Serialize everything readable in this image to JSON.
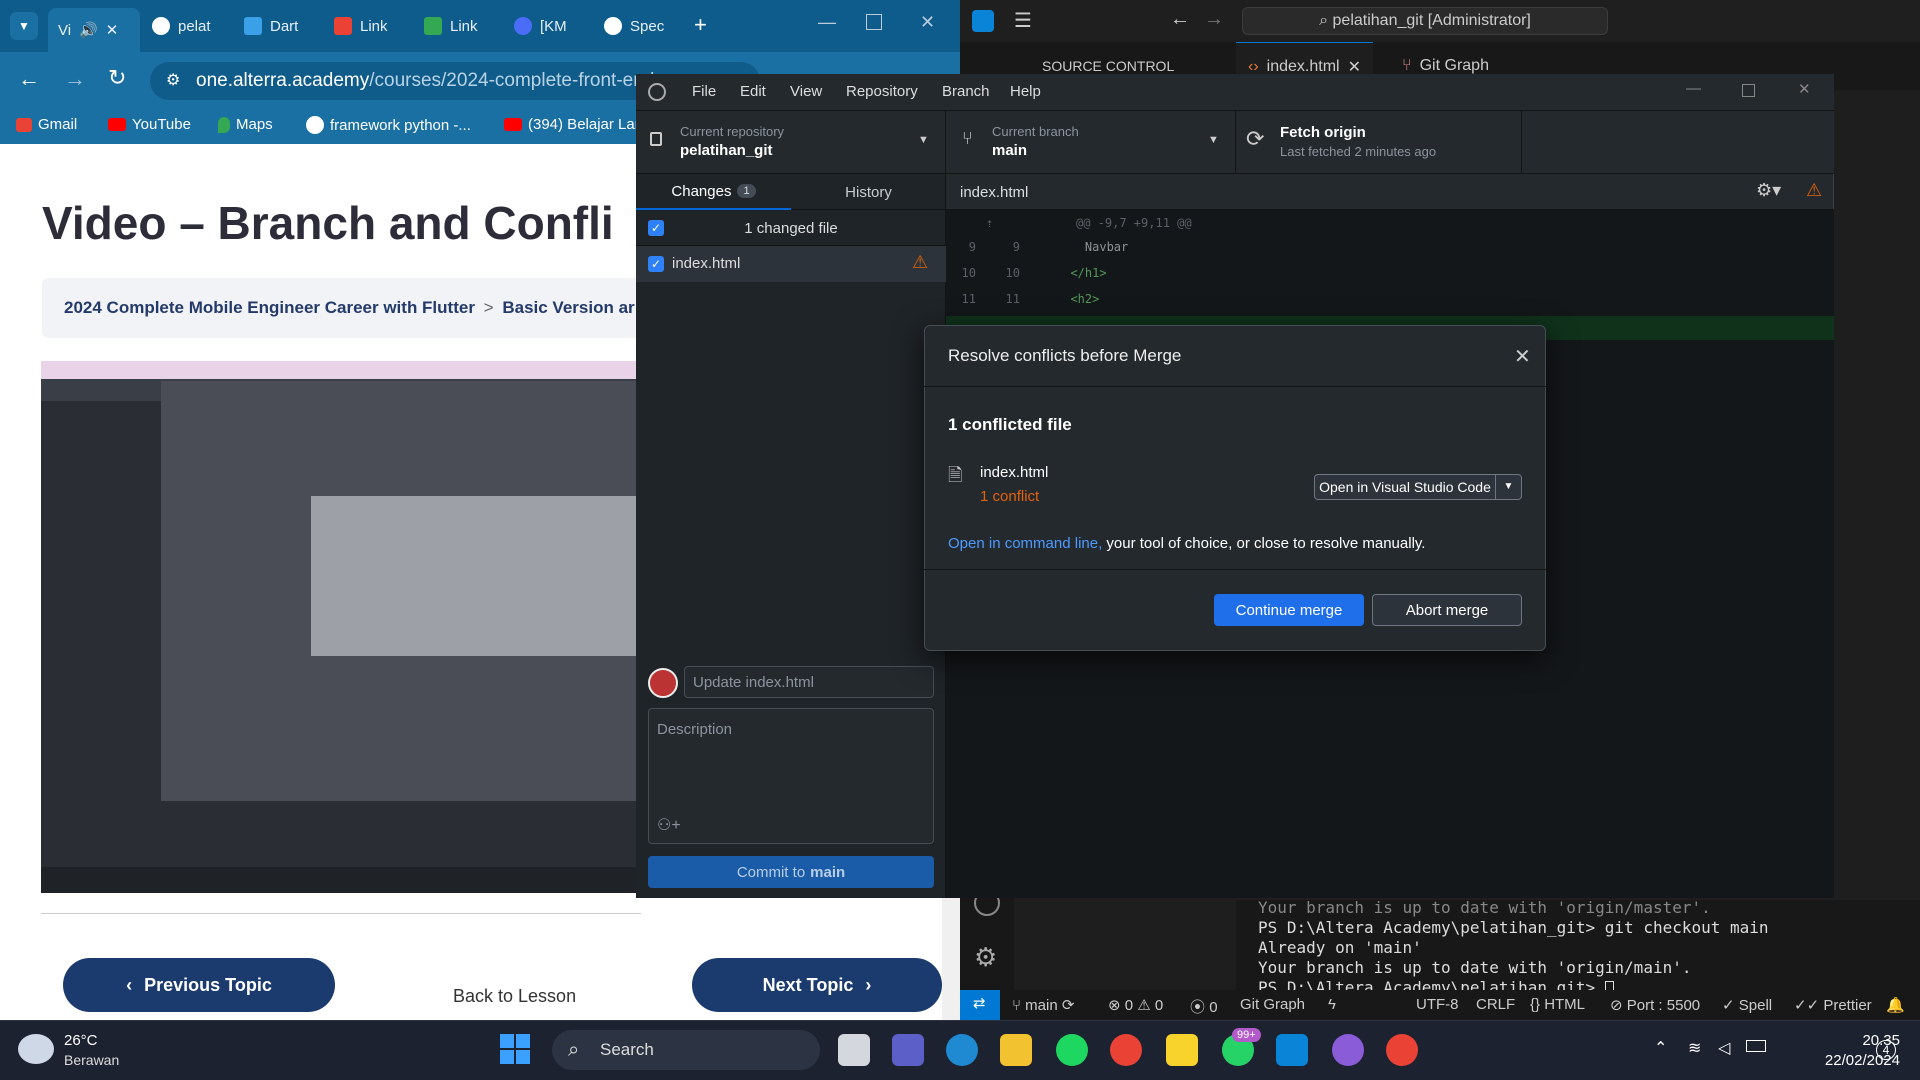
{
  "chrome": {
    "tabs": [
      {
        "label": "Vi",
        "color": "#e0e0e0"
      },
      {
        "label": "pelat",
        "color": "#ffffff"
      },
      {
        "label": "Dart",
        "color": "#3aa0e8"
      },
      {
        "label": "Link",
        "color": "#ea4335"
      },
      {
        "label": "Link",
        "color": "#34a853"
      },
      {
        "label": "[KM",
        "color": "#4a6cf7"
      },
      {
        "label": "Spec",
        "color": "#ffffff"
      }
    ],
    "url_host": "one.alterra.academy",
    "url_path": "/courses/2024-complete-front-end-e",
    "bookmarks": [
      "Gmail",
      "YouTube",
      "Maps",
      "framework python -...",
      "(394) Belajar Lar"
    ]
  },
  "lesson": {
    "title": "Video – Branch and Confli",
    "breadcrumb_course": "2024 Complete Mobile Engineer Career with Flutter",
    "breadcrumb_sep": ">",
    "breadcrumb_topic": "Basic Version ar",
    "prev_label": "Previous Topic",
    "next_label": "Next Topic",
    "back_label": "Back to Lesson"
  },
  "vscode": {
    "search": "pelatihan_git [Administrator]",
    "source_control": "SOURCE CONTROL",
    "tab_file": "index.html",
    "tab_git": "Git Graph",
    "terminal": [
      "Your branch is up to date with 'origin/master'.",
      "PS D:\\Altera Academy\\pelatihan_git> git checkout main",
      "Already on 'main'",
      "Your branch is up to date with 'origin/main'.",
      "PS D:\\Altera Academy\\pelatihan_git> "
    ],
    "status": {
      "branch": "main",
      "errors": "0",
      "warnings": "0",
      "ports": "0",
      "git_graph": "Git Graph",
      "encoding": "UTF-8",
      "eol": "CRLF",
      "lang": "HTML",
      "port": "Port : 5500",
      "spell": "Spell",
      "prettier": "Prettier"
    }
  },
  "github_desktop": {
    "menu": [
      "File",
      "Edit",
      "View",
      "Repository",
      "Branch",
      "Help"
    ],
    "repo_label": "Current repository",
    "repo_name": "pelatihan_git",
    "branch_label": "Current branch",
    "branch_name": "main",
    "fetch_title": "Fetch origin",
    "fetch_sub": "Last fetched 2 minutes ago",
    "tab_changes": "Changes",
    "changes_count": "1",
    "tab_history": "History",
    "changed_files": "1 changed file",
    "file_name": "index.html",
    "summary_placeholder": "Update index.html",
    "description_placeholder": "Description",
    "commit_prefix": "Commit to",
    "commit_branch": "main",
    "diff_file": "index.html",
    "hunk": "@@ -9,7 +9,11 @@",
    "diff_lines": [
      {
        "old": "9",
        "new": "9",
        "text": "    Navbar"
      },
      {
        "old": "10",
        "new": "10",
        "text": "  </h1>"
      },
      {
        "old": "11",
        "new": "11",
        "text": "  <h2>"
      }
    ]
  },
  "dialog": {
    "title": "Resolve conflicts before Merge",
    "count": "1 conflicted file",
    "file": "index.html",
    "conflict": "1 conflict",
    "open_btn": "Open in Visual Studio Code",
    "msg_link": "Open in command line,",
    "msg_rest": " your tool of choice, or close to resolve manually.",
    "continue": "Continue merge",
    "abort": "Abort merge"
  },
  "taskbar": {
    "temp": "26°C",
    "weather": "Berawan",
    "search": "Search",
    "whatsapp_badge": "99+",
    "notif_count": "4",
    "time": "20.35",
    "date": "22/02/2024"
  }
}
